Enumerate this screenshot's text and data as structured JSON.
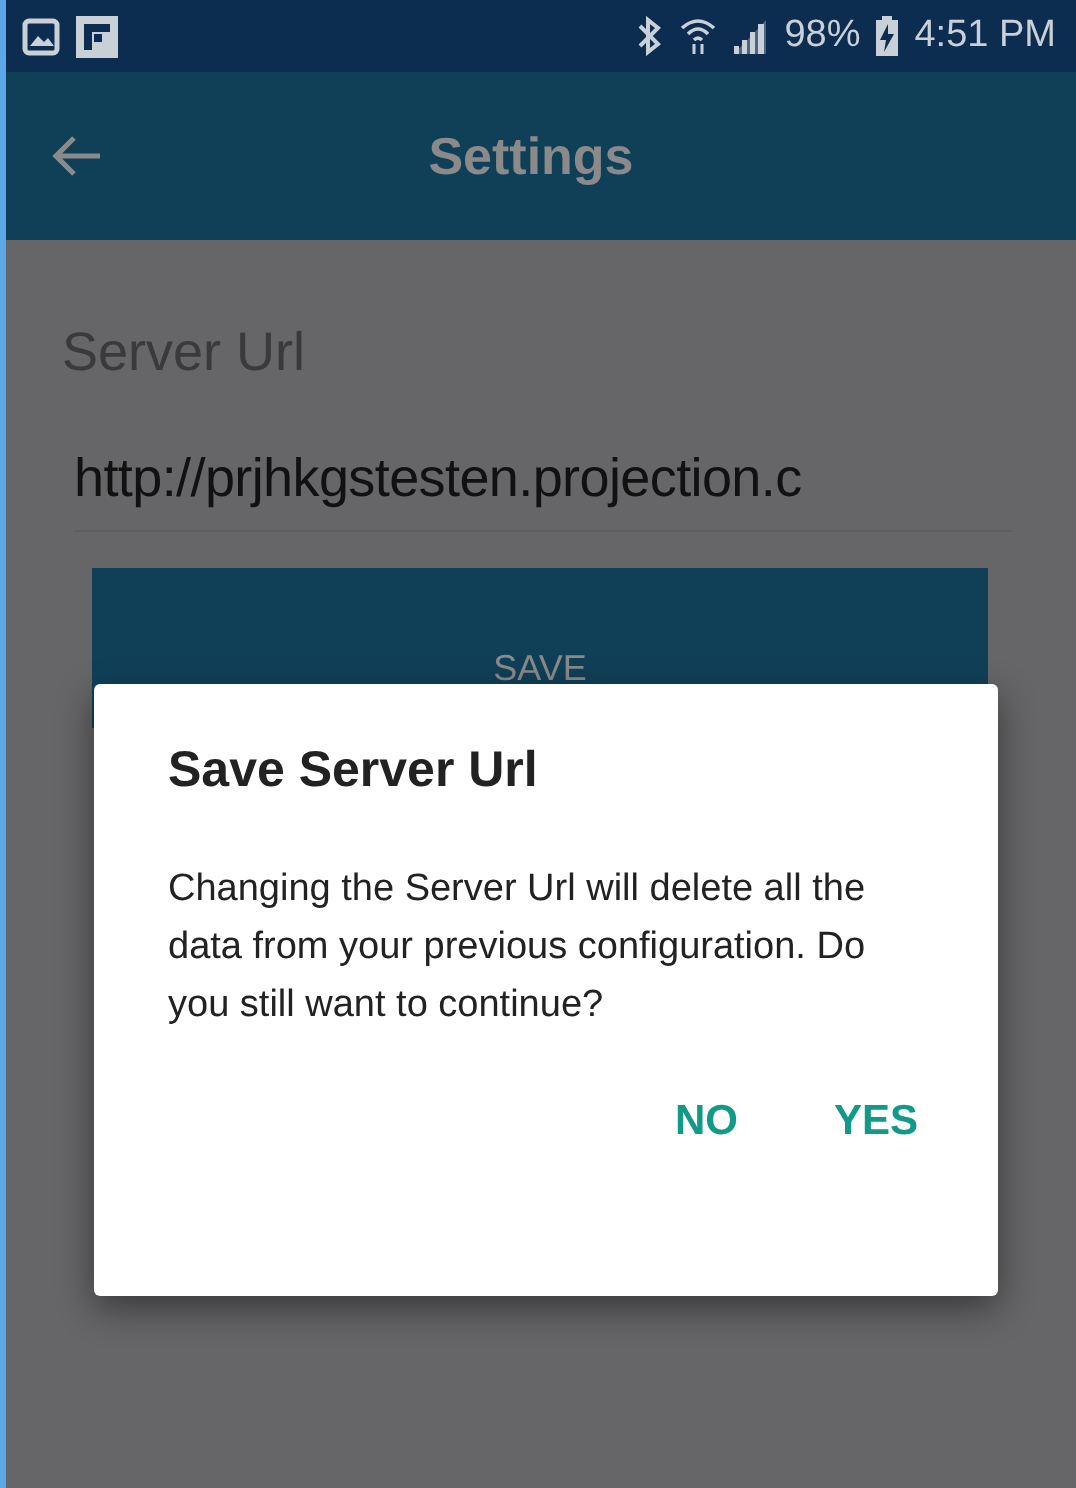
{
  "status_bar": {
    "battery": "98%",
    "time": "4:51 PM"
  },
  "app_bar": {
    "title": "Settings"
  },
  "form": {
    "label": "Server Url",
    "value": "http://prjhkgstesten.projection.c",
    "button": "SAVE"
  },
  "dialog": {
    "title": "Save Server Url",
    "message": "Changing the Server Url will delete all the data from your previous configuration. Do you still want to continue?",
    "buttons": [
      "NO",
      "YES"
    ]
  }
}
